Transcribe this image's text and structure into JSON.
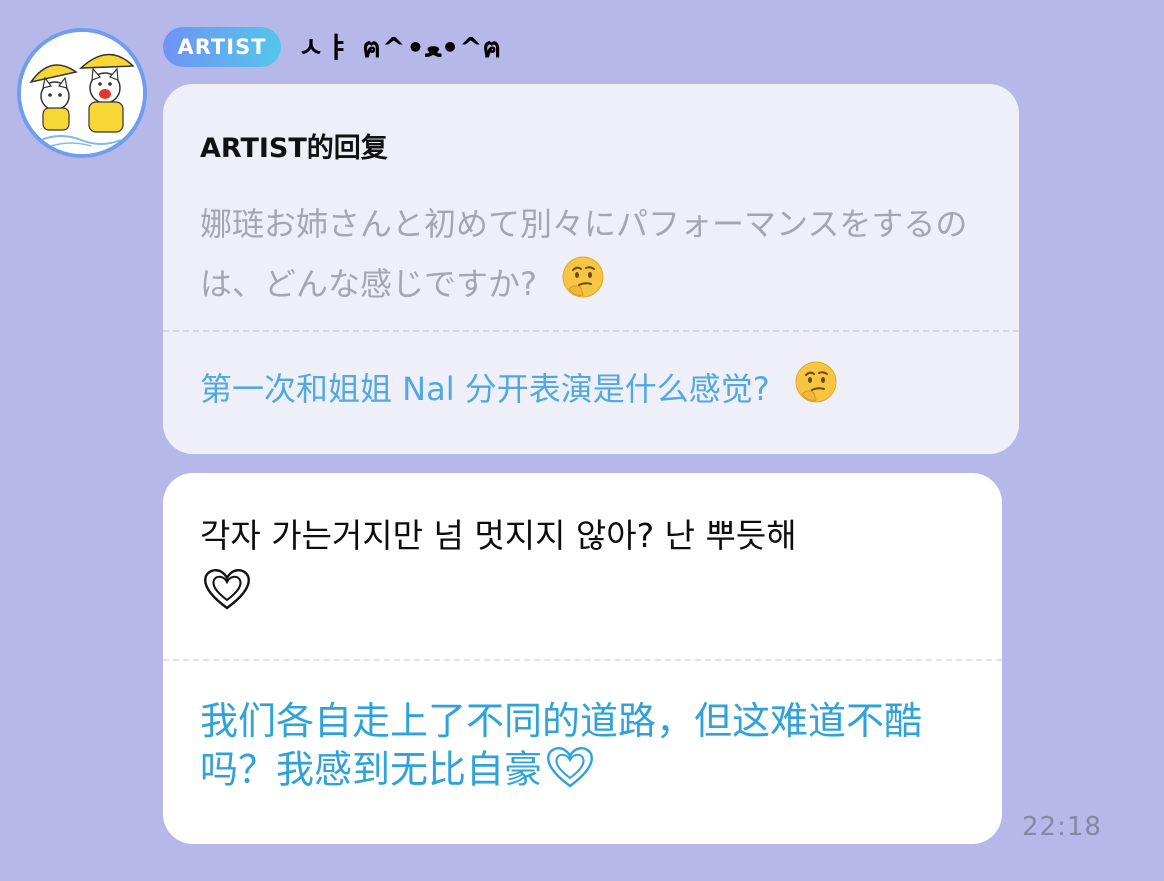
{
  "header": {
    "badge_label": "ARTIST",
    "sender_name": "ㅅㅑ ฅ^•ﻌ•^ฅ"
  },
  "reply_card": {
    "label": "ARTIST的回复",
    "question": "娜琏お姉さんと初めて別々にパフォーマンスをするのは、どんな感じですか?",
    "translation": "第一次和姐姐 Nal 分开表演是什么感觉?",
    "emoji": "thinking-face-icon"
  },
  "message_card": {
    "message": "각자 가는거지만 넘 멋지지 않아? 난 뿌듯해",
    "translation": "我们各自走上了不同的道路，但这难道不酷吗？我感到无比自豪",
    "heart_icon": "heart-outline-icon"
  },
  "timestamp": "22:18",
  "colors": {
    "background": "#b7b8ea",
    "badge_start": "#6f93f5",
    "badge_end": "#53c6ea",
    "translation": "#2fa2da",
    "question": "#a6a6ae"
  }
}
